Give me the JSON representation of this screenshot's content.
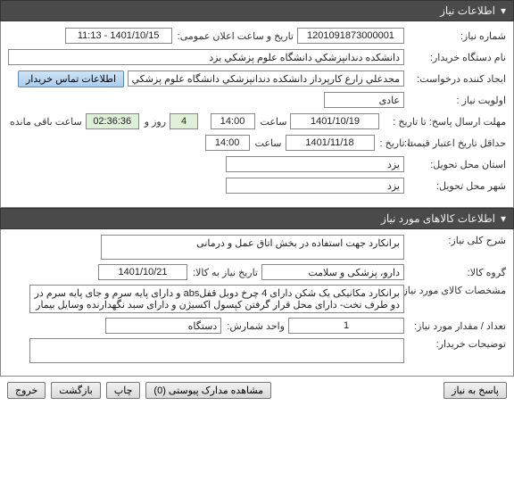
{
  "section1": {
    "title": "اطلاعات نیاز",
    "need_number_label": "شماره نیاز:",
    "need_number": "1201091873000001",
    "public_announce_label": "تاریخ و ساعت اعلان عمومی:",
    "public_announce": "1401/10/15 - 11:13",
    "buyer_org_label": "نام دستگاه خریدار:",
    "buyer_org": "دانشکده دندانپزشکي دانشگاه علوم پزشکي يزد",
    "requester_label": "ایجاد کننده درخواست:",
    "requester": "مجدعلي زارع کارپرداز دانشکده دندانپزشکي دانشگاه علوم پزشکي يزد",
    "buyer_contact_btn": "اطلاعات تماس خریدار",
    "priority_label": "اولویت نیاز :",
    "priority": "عادی",
    "response_deadline_label": "مهلت ارسال پاسخ:    تا تاریخ :",
    "response_deadline_date": "1401/10/19",
    "saat_label": "ساعت",
    "response_deadline_time": "14:00",
    "days_remaining": "4",
    "roz_va": "روز و",
    "time_remaining": "02:36:36",
    "remaining_suffix": "ساعت باقی مانده",
    "validity_label": "حداقل تاریخ اعتبار قیمت:",
    "validity_to": "تا تاریخ :",
    "validity_date": "1401/11/18",
    "validity_time": "14:00",
    "province_label": "استان محل تحویل:",
    "province": "يزد",
    "city_label": "شهر محل تحویل:",
    "city": "يزد"
  },
  "section2": {
    "title": "اطلاعات کالاهای مورد نیاز",
    "general_desc_label": "شرح کلی نیاز:",
    "general_desc": "برانکارد جهت استفاده در بخش اتاق عمل و درمانی",
    "group_label": "گروه کالا:",
    "group": "دارو، پزشکی و سلامت",
    "need_by_label": "تاریخ نیاز به کالا:",
    "need_by": "1401/10/21",
    "spec_label": "مشخصات کالای مورد نیاز:",
    "spec": "برانکارد مکانیکی یک شکن دارای 4 چرخ دوبل قفلabs و دارای پایه سرم و جای پایه سرم در دو طرف تخت- دارای محل قرار گرفتن کپسول اکسیژن و دارای سبد نگهدارنده وسایل بیمار",
    "qty_label": "تعداد / مقدار مورد نیاز:",
    "qty": "1",
    "unit_label": "واحد شمارش:",
    "unit": "دستگاه",
    "buyer_notes_label": "توضیحات خریدار:"
  },
  "footer": {
    "respond": "پاسخ به نیاز",
    "attachments": "مشاهده مدارک پیوستی (0)",
    "print": "چاپ",
    "back": "بازگشت",
    "exit": "خروج"
  }
}
